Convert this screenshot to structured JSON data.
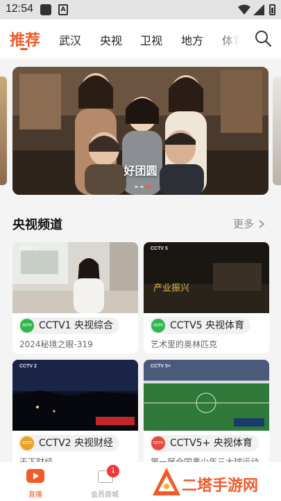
{
  "status_bar": {
    "time": "12:54"
  },
  "tabs": [
    "推荐",
    "武汉",
    "央视",
    "卫视",
    "地方",
    "体育"
  ],
  "banner": {
    "title": "好团圆"
  },
  "section": {
    "title": "央视频道",
    "more_label": "更多"
  },
  "channels": [
    {
      "name": "CCTV1 央视综合",
      "subtitle": "2024秘境之眼-319",
      "logo_color": "#2db84d"
    },
    {
      "name": "CCTV5 央视体育",
      "subtitle": "艺术里的奥林匹克",
      "logo_color": "#2db84d"
    },
    {
      "name": "CCTV2 央视财经",
      "subtitle": "天下财经",
      "logo_color": "#f0a020"
    },
    {
      "name": "CCTV5+ 央视体育",
      "subtitle": "第一届全国青少年三大球运动",
      "logo_color": "#e84a3c"
    }
  ],
  "bottom_nav": {
    "live_label": "直播",
    "shop_label": "会员商城",
    "shop_badge": "1"
  },
  "watermark": {
    "text": "二塔手游网"
  },
  "colors": {
    "accent": "#f25a28"
  }
}
